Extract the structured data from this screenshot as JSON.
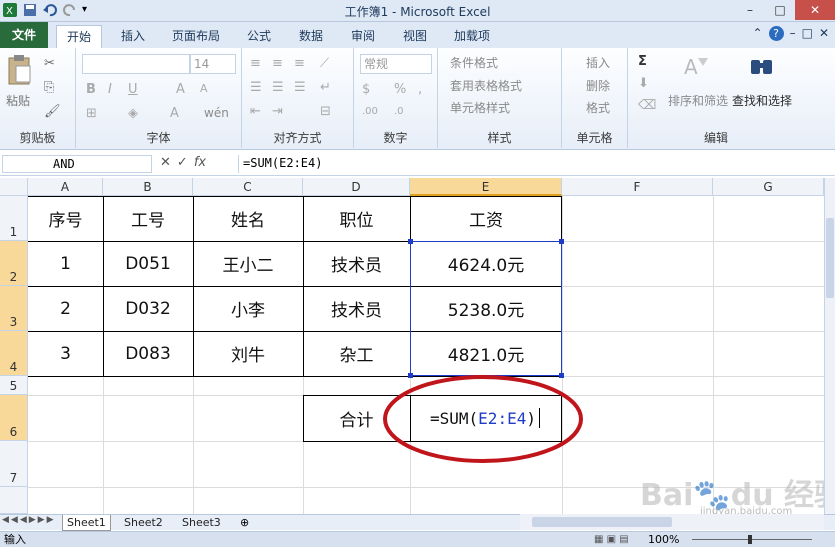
{
  "window": {
    "title": "工作簿1 - Microsoft Excel",
    "controls": [
      "–",
      "□",
      "✕"
    ]
  },
  "ribbon_tabs": [
    "文件",
    "开始",
    "插入",
    "页面布局",
    "公式",
    "数据",
    "审阅",
    "视图",
    "加载项"
  ],
  "ribbon": {
    "clipboard": {
      "paste": "粘贴",
      "label": "剪贴板"
    },
    "font": {
      "name": "",
      "size": "14",
      "label": "字体",
      "phonetic": "wén"
    },
    "alignment": {
      "label": "对齐方式"
    },
    "number": {
      "format": "常规",
      "label": "数字"
    },
    "styles": {
      "cond": "条件格式",
      "table": "套用表格格式",
      "cell": "单元格样式",
      "label": "样式"
    },
    "cells": {
      "insert": "插入",
      "delete": "删除",
      "format": "格式",
      "label": "单元格"
    },
    "editing": {
      "sort": "排序和筛选",
      "find": "查找和选择",
      "label": "编辑",
      "sigma": "Σ"
    }
  },
  "formula_bar": {
    "name_box": "AND",
    "formula": "=SUM(E2:E4)",
    "fx": "fx"
  },
  "columns": [
    "A",
    "B",
    "C",
    "D",
    "E",
    "F",
    "G"
  ],
  "rows": [
    "1",
    "2",
    "3",
    "4",
    "5",
    "6",
    "7"
  ],
  "table": {
    "headers": [
      "序号",
      "工号",
      "姓名",
      "职位",
      "工资"
    ],
    "rows": [
      [
        "1",
        "D051",
        "王小二",
        "技术员",
        "4624.0元"
      ],
      [
        "2",
        "D032",
        "小李",
        "技术员",
        "5238.0元"
      ],
      [
        "3",
        "D083",
        "刘牛",
        "杂工",
        "4821.0元"
      ]
    ],
    "total_label": "合计",
    "total_formula_prefix": "=SUM(",
    "total_formula_ref": "E2:E4",
    "total_formula_suffix": ")"
  },
  "sheets": [
    "Sheet1",
    "Sheet2",
    "Sheet3"
  ],
  "status": {
    "mode": "输入",
    "zoom": "100%"
  },
  "colors": {
    "accent": "#2a6b3c",
    "ref_blue": "#1f3cc8",
    "circle": "#c0151b"
  },
  "watermark": "Bai du 经验 jingyan.baidu.com"
}
